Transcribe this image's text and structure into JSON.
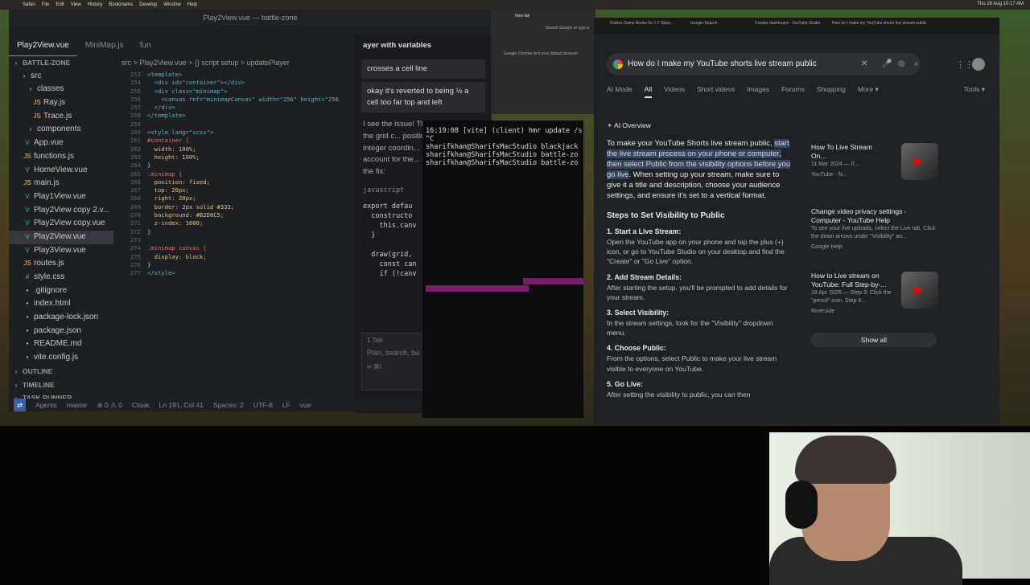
{
  "menubar": {
    "items": [
      "Safari",
      "File",
      "Edit",
      "View",
      "History",
      "Bookmarks",
      "Develop",
      "Window",
      "Help"
    ],
    "clock": "Thu 28 Aug  10:17 AM"
  },
  "vscode": {
    "title": "Play2View.vue — battle-zone",
    "tabs": [
      "Play2View.vue",
      "MiniMap.js",
      "fun"
    ],
    "breadcrumbs": "src  >  Play2View.vue  >  {} script setup  >  updatePlayer",
    "explorer": [
      {
        "label": "BATTLE-ZONE",
        "kind": "header"
      },
      {
        "label": "src",
        "kind": "folder"
      },
      {
        "label": "classes",
        "kind": "folder"
      },
      {
        "label": "Ray.js",
        "kind": "js"
      },
      {
        "label": "Trace.js",
        "kind": "js"
      },
      {
        "label": "components",
        "kind": "folder"
      },
      {
        "label": "App.vue",
        "kind": "vue"
      },
      {
        "label": "functions.js",
        "kind": "js"
      },
      {
        "label": "HomeView.vue",
        "kind": "vue"
      },
      {
        "label": "main.js",
        "kind": "js"
      },
      {
        "label": "Play1View.vue",
        "kind": "vue"
      },
      {
        "label": "Play2View copy 2.v...",
        "kind": "vue"
      },
      {
        "label": "Play2View copy.vue",
        "kind": "vue"
      },
      {
        "label": "Play2View.vue",
        "kind": "vue",
        "selected": true
      },
      {
        "label": "Play3View.vue",
        "kind": "vue"
      },
      {
        "label": "routes.js",
        "kind": "js"
      },
      {
        "label": "style.css",
        "kind": "css"
      },
      {
        "label": ".gitignore",
        "kind": "other"
      },
      {
        "label": "index.html",
        "kind": "other"
      },
      {
        "label": "package-lock.json",
        "kind": "other"
      },
      {
        "label": "package.json",
        "kind": "other"
      },
      {
        "label": "README.md",
        "kind": "other"
      },
      {
        "label": "vite.config.js",
        "kind": "other"
      },
      {
        "label": "OUTLINE",
        "kind": "header"
      },
      {
        "label": "TIMELINE",
        "kind": "header"
      },
      {
        "label": "TASK RUNNER",
        "kind": "header"
      }
    ],
    "code": [
      {
        "n": "253",
        "t": "<template>"
      },
      {
        "n": "254",
        "t": "  <div id=\"container\"></div>"
      },
      {
        "n": "255",
        "t": "  <div class=\"minimap\">"
      },
      {
        "n": "256",
        "t": "    <canvas ref=\"minimapCanvas\" width=\"256\" height=\"256"
      },
      {
        "n": "257",
        "t": "  </div>"
      },
      {
        "n": "258",
        "t": "</template>"
      },
      {
        "n": "259",
        "t": ""
      },
      {
        "n": "260",
        "t": "<style lang=\"scss\">"
      },
      {
        "n": "261",
        "t": "#container {"
      },
      {
        "n": "262",
        "t": "  width: 100%;"
      },
      {
        "n": "263",
        "t": "  height: 100%;"
      },
      {
        "n": "264",
        "t": "}"
      },
      {
        "n": "265",
        "t": ".minimap {"
      },
      {
        "n": "266",
        "t": "  position: fixed;"
      },
      {
        "n": "267",
        "t": "  top: 20px;"
      },
      {
        "n": "268",
        "t": "  right: 20px;"
      },
      {
        "n": "269",
        "t": "  border: 2px solid #333;"
      },
      {
        "n": "270",
        "t": "  background: #B2D8C5;"
      },
      {
        "n": "271",
        "t": "  z-index: 1000;"
      },
      {
        "n": "272",
        "t": "}"
      },
      {
        "n": "273",
        "t": ""
      },
      {
        "n": "274",
        "t": ".minimap canvas {"
      },
      {
        "n": "275",
        "t": "  display: block;"
      },
      {
        "n": "276",
        "t": "}"
      },
      {
        "n": "277",
        "t": "</style>"
      }
    ],
    "status": {
      "remote": "⇄",
      "agents": "Agents",
      "branch": "master",
      "problems": "⊗ 0 ⚠ 0",
      "cloak": "Cloak",
      "pos": "Ln 191, Col 41",
      "spaces": "Spaces: 2",
      "enc": "UTF-8",
      "eol": "LF",
      "lang": "vue"
    }
  },
  "chat": {
    "title": "ayer with variables",
    "b1": "crosses a cell line",
    "b2": "okay it's reverted to being ½ a cell too far top and left",
    "reply": "I see the issue! The problem is that the grid c... positioned base... integer coordin... player position... account for the... offset within the... the fix:",
    "lang": "javascript",
    "codelines": [
      "export defau",
      "  constructo",
      "    this.canv",
      "  }",
      "",
      "  draw(grid,",
      "    const can",
      "    if (!canv"
    ],
    "tab": "1 Tab",
    "placeholder": "Plan, search, bu",
    "mode": "∞ ⌘I"
  },
  "terminal": {
    "lines": [
      "16:19:08 [vite] (client) hmr update /src/",
      "^C",
      "sharifkhan@SharifsMacStudio blackjack",
      "sharifkhan@SharifsMacStudio battle-zo",
      "sharifkhan@SharifsMacStudio battle-zo"
    ]
  },
  "chrome": {
    "tabs": [
      "Roblox Game Books for 1-7 Stars...",
      "Google Search",
      "Creator dashboard - YouTube Studio",
      "How do I make my YouTube shorts live stream public",
      "Search Google or type a"
    ],
    "newtab": "New tab",
    "default_browser": "Google Chrome isn't your default browser",
    "query": "How do I make my YouTube shorts live stream public",
    "nav": [
      "AI Mode",
      "All",
      "Videos",
      "Short videos",
      "Images",
      "Forums",
      "Shopping",
      "More ▾"
    ],
    "tools": "Tools ▾",
    "ai_label": "AI Overview",
    "intro1": "To make your YouTube Shorts live stream public, ",
    "intro_hl": "start the live stream process on your phone or computer, then select Public from the visibility options before you go live",
    "intro2": ". When setting up your stream, make sure to give it a title and description, choose your audience settings, and ensure it's set to a vertical format.",
    "steps_title": "Steps to Set Visibility to Public",
    "steps": [
      {
        "t": "1. Start a Live Stream:",
        "d": "Open the YouTube app on your phone and tap the plus (+) icon, or go to YouTube Studio on your desktop and find the \"Create\" or \"Go Live\" option."
      },
      {
        "t": "2. Add Stream Details:",
        "d": "After starting the setup, you'll be prompted to add details for your stream."
      },
      {
        "t": "3. Select Visibility:",
        "d": "In the stream settings, look for the \"Visibility\" dropdown menu."
      },
      {
        "t": "4. Choose Public:",
        "d": "From the options, select Public to make your live stream visible to everyone on YouTube."
      },
      {
        "t": "5. Go Live:",
        "d": "After setting the visibility to public, you can then"
      }
    ],
    "cards": [
      {
        "t": "How To Live Stream On...",
        "d": "11 Mar 2024 — If...",
        "s": "YouTube · N..."
      },
      {
        "t": "Change video privacy settings - Computer - YouTube Help",
        "d": "To see your live uploads, select the Live tab. Click the down arrows under \"Visibility\" an...",
        "s": "Google Help"
      },
      {
        "t": "How to Live stream on YouTube: Full Step-by-...",
        "d": "18 Apr 2025 — Step 3: Click the \"pencil\" icon. Step 4:...",
        "s": "Riverside"
      }
    ],
    "showall": "Show all"
  }
}
